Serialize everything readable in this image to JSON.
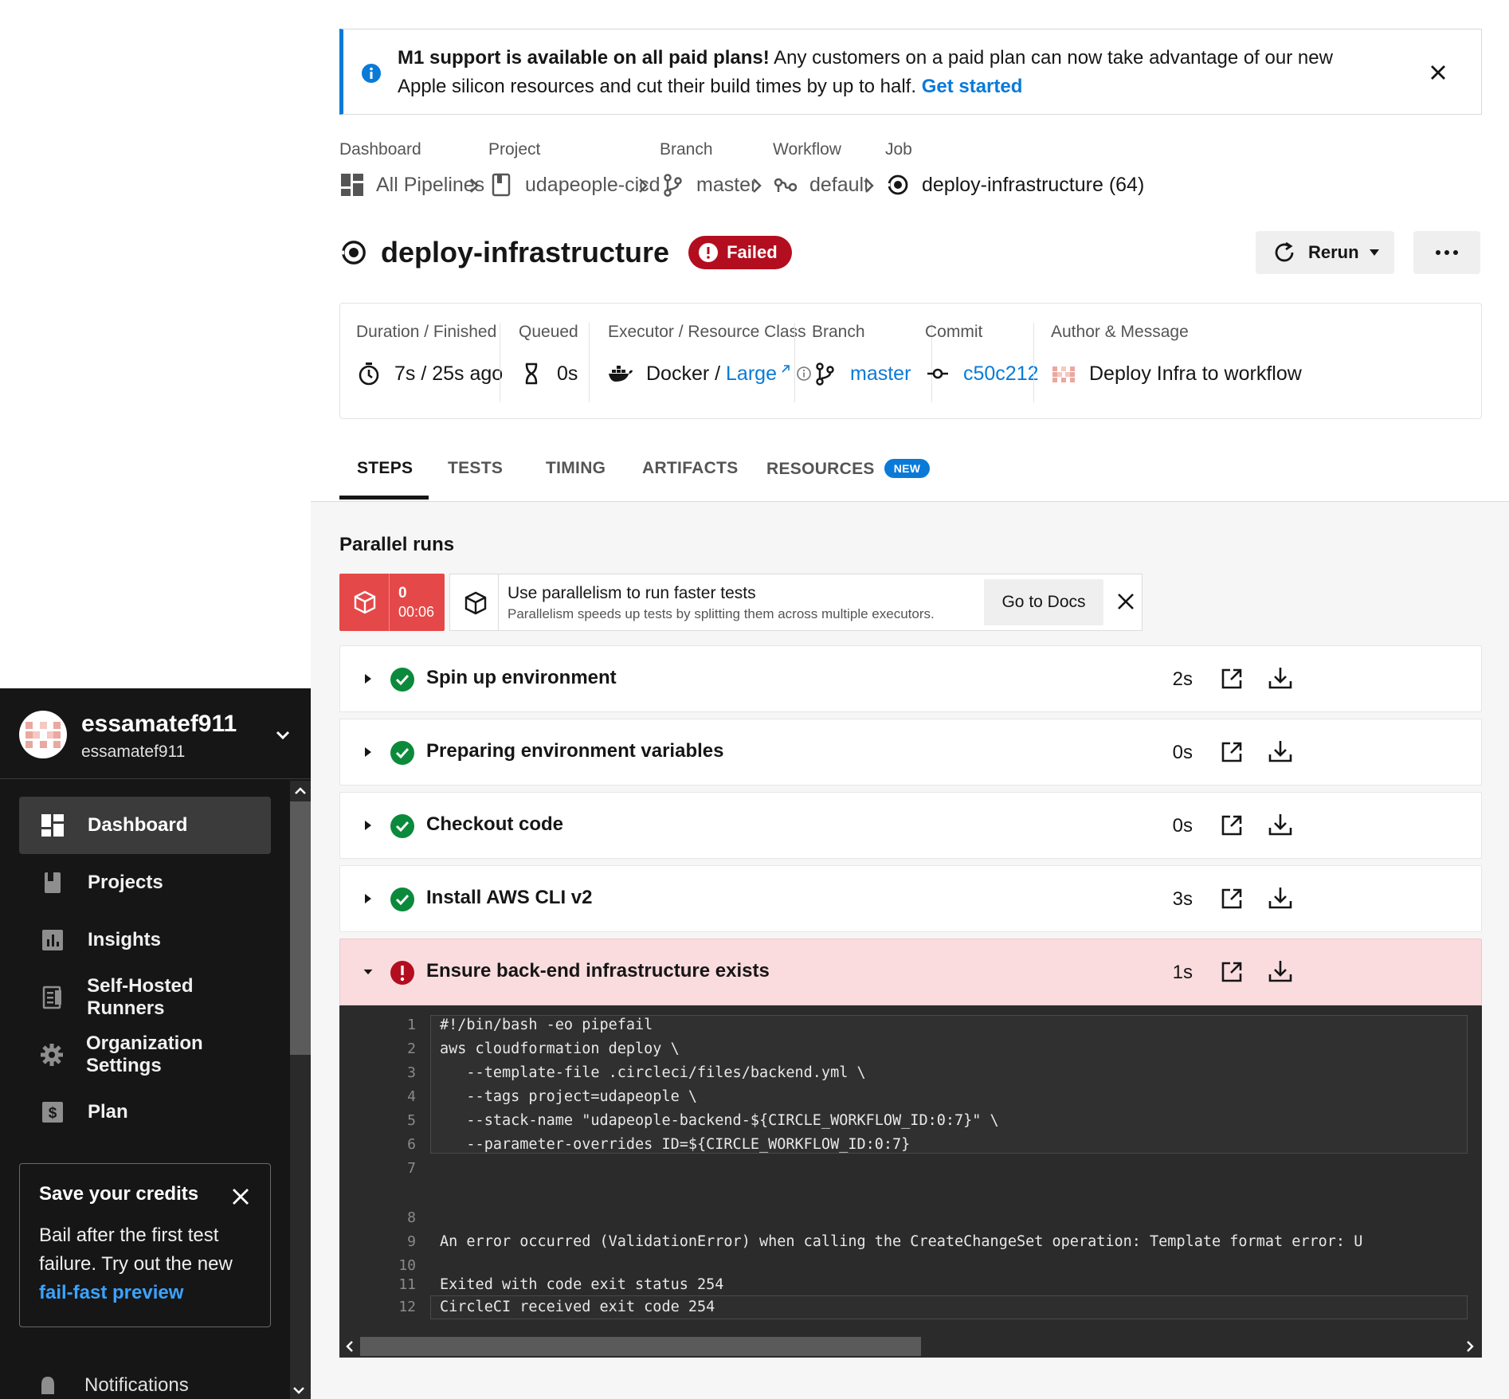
{
  "org": {
    "name": "essamatef911",
    "sub": "essamatef911"
  },
  "nav": {
    "items": [
      {
        "label": "Dashboard",
        "icon": "dashboard-icon"
      },
      {
        "label": "Projects",
        "icon": "project-icon"
      },
      {
        "label": "Insights",
        "icon": "insights-icon"
      },
      {
        "label": "Self-Hosted Runners",
        "icon": "runners-icon"
      },
      {
        "label": "Organization Settings",
        "icon": "gear-icon"
      },
      {
        "label": "Plan",
        "icon": "dollar-icon"
      }
    ],
    "notifications_label": "Notifications"
  },
  "credits": {
    "title": "Save your credits",
    "body": "Bail after the first test failure. Try out the new",
    "link": "fail-fast preview"
  },
  "banner": {
    "bold": "M1 support is available on all paid plans!",
    "text": " Any customers on a paid plan can now take advantage of our new Apple silicon resources and cut their build times by up to half. ",
    "link": "Get started"
  },
  "breadcrumbs": [
    {
      "label": "Dashboard",
      "value": "All Pipelines",
      "icon": "dashboard-icon"
    },
    {
      "label": "Project",
      "value": "udapeople-cicd",
      "icon": "project-icon"
    },
    {
      "label": "Branch",
      "value": "master",
      "icon": "branch-icon"
    },
    {
      "label": "Workflow",
      "value": "default",
      "icon": "workflow-icon"
    },
    {
      "label": "Job",
      "value": "deploy-infrastructure (64)",
      "icon": "job-icon"
    }
  ],
  "job": {
    "title": "deploy-infrastructure",
    "status": "Failed",
    "rerun_label": "Rerun"
  },
  "meta": {
    "duration": {
      "label": "Duration / Finished",
      "value": "7s / 25s ago"
    },
    "queued": {
      "label": "Queued",
      "value": "0s"
    },
    "executor": {
      "label": "Executor / Resource Class",
      "prefix": "Docker / ",
      "link": "Large"
    },
    "branch": {
      "label": "Branch",
      "value": "master"
    },
    "commit": {
      "label": "Commit",
      "value": "c50c212"
    },
    "author": {
      "label": "Author & Message",
      "value": "Deploy Infra to workflow"
    }
  },
  "tabs": [
    {
      "label": "STEPS",
      "active": true
    },
    {
      "label": "TESTS",
      "active": false
    },
    {
      "label": "TIMING",
      "active": false
    },
    {
      "label": "ARTIFACTS",
      "active": false
    },
    {
      "label": "RESOURCES",
      "active": false,
      "badge": "NEW"
    }
  ],
  "parallel": {
    "title": "Parallel runs",
    "run_index": "0",
    "run_time": "00:06",
    "promo_title": "Use parallelism to run faster tests",
    "promo_sub": "Parallelism speeds up tests by splitting them across multiple executors.",
    "docs_label": "Go to Docs"
  },
  "steps": [
    {
      "name": "Spin up environment",
      "duration": "2s",
      "status": "success"
    },
    {
      "name": "Preparing environment variables",
      "duration": "0s",
      "status": "success"
    },
    {
      "name": "Checkout code",
      "duration": "0s",
      "status": "success"
    },
    {
      "name": "Install AWS CLI v2",
      "duration": "3s",
      "status": "success"
    },
    {
      "name": "Ensure back-end infrastructure exists",
      "duration": "1s",
      "status": "failed"
    }
  ],
  "console": {
    "lines": [
      {
        "n": "1",
        "text": "#!/bin/bash -eo pipefail"
      },
      {
        "n": "2",
        "text": "aws cloudformation deploy \\"
      },
      {
        "n": "3",
        "text": "   --template-file .circleci/files/backend.yml \\"
      },
      {
        "n": "4",
        "text": "   --tags project=udapeople \\"
      },
      {
        "n": "5",
        "text": "   --stack-name \"udapeople-backend-${CIRCLE_WORKFLOW_ID:0:7}\" \\"
      },
      {
        "n": "6",
        "text": "   --parameter-overrides ID=${CIRCLE_WORKFLOW_ID:0:7}"
      },
      {
        "n": "7",
        "text": ""
      },
      {
        "n": "8",
        "text": ""
      },
      {
        "n": "9",
        "text": "An error occurred (ValidationError) when calling the CreateChangeSet operation: Template format error: U"
      },
      {
        "n": "10",
        "text": ""
      },
      {
        "n": "11",
        "text": "Exited with code exit status 254"
      },
      {
        "n": "12",
        "text": "CircleCI received exit code 254"
      }
    ]
  },
  "colors": {
    "accent": "#0a7ad8",
    "failed": "#b30e1f",
    "success": "#0c8a3c",
    "sidebar": "#161616"
  }
}
